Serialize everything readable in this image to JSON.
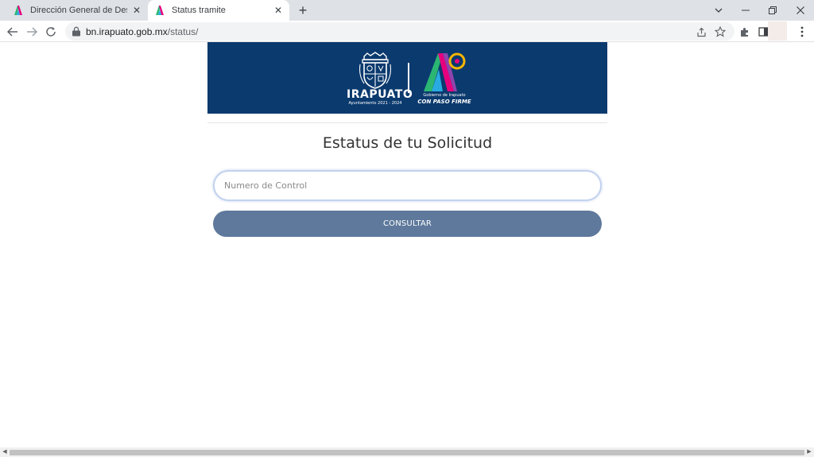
{
  "browser": {
    "tabs": [
      {
        "title": "Dirección General de Desarrollo U",
        "active": false
      },
      {
        "title": "Status tramite",
        "active": true
      }
    ],
    "new_tab_label": "+",
    "url_host": "bn.irapuato.gob.mx",
    "url_path": "/status/"
  },
  "banner": {
    "city_name": "IRAPUATO",
    "city_subtitle": "Ayuntamiento 2021 - 2024",
    "gov_line": "Gobierno de Irapuato",
    "slogan": "CON PASO FIRME",
    "background_color": "#0b3a6e"
  },
  "main": {
    "title": "Estatus de tu Solicitud",
    "control_placeholder": "Numero de Control",
    "control_value": "",
    "consult_label": "CONSULTAR",
    "button_color": "#5e799c"
  }
}
